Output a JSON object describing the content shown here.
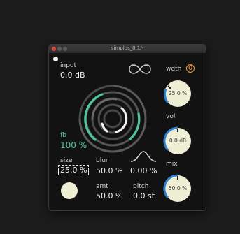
{
  "window": {
    "title": "simplos_0.1/-"
  },
  "input": {
    "label": "input",
    "value": "0.0 dB"
  },
  "feedback": {
    "label": "fb",
    "value": "100 %"
  },
  "width": {
    "label": "wdth",
    "badge": "0",
    "knob_value": "25.0 %",
    "level": 0.25
  },
  "volume": {
    "label": "vol",
    "knob_value": "0.0 dB",
    "level": 0.5
  },
  "mix": {
    "label": "mix",
    "knob_value": "50.0 %",
    "level": 0.5
  },
  "size": {
    "label": "size",
    "value": "25.0 %"
  },
  "blur": {
    "label": "blur",
    "value": "50.0 %"
  },
  "curve": {
    "value": "0.00 %"
  },
  "amount": {
    "label": "amt",
    "value": "50.0 %"
  },
  "pitch": {
    "label": "pitch",
    "value": "0.0 st"
  },
  "colors": {
    "accent": "#4fc79a",
    "knob_face": "#efefd6",
    "knob_arc": "#2f7fd0",
    "badge": "#f0a030"
  }
}
